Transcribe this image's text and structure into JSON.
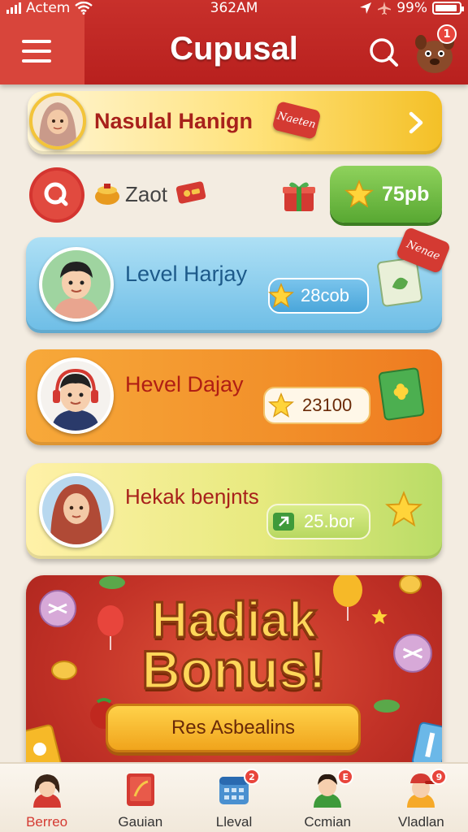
{
  "status_bar": {
    "carrier": "Actem",
    "time": "362AM",
    "battery": "99%"
  },
  "header": {
    "title": "Cupusal",
    "notification_count": "1"
  },
  "rows": {
    "profile": {
      "name": "Nasulal Hanign",
      "tag": "Naeten"
    },
    "reward": {
      "label": "Zaot",
      "coins": "75pb"
    },
    "levels": [
      {
        "name": "Level Harjay",
        "score": "28cob",
        "tag": "Nenae"
      },
      {
        "name": "Hevel Dajay",
        "score": "23100"
      },
      {
        "name": "Hekak benjnts",
        "score": "25.bor"
      }
    ]
  },
  "bonus": {
    "title_line1": "Hadiak",
    "title_line2": "Bonus!",
    "button_label": "Res Asbealins"
  },
  "bottom_nav": {
    "items": [
      {
        "label": "Berreo",
        "badge": ""
      },
      {
        "label": "Gauian",
        "badge": ""
      },
      {
        "label": "Lleval",
        "badge": "2"
      },
      {
        "label": "Ccmian",
        "badge": "E"
      },
      {
        "label": "Vladlan",
        "badge": "9"
      }
    ],
    "active_index": 0
  },
  "colors": {
    "header_red": "#c0281f",
    "active_nav": "#d43a32"
  }
}
